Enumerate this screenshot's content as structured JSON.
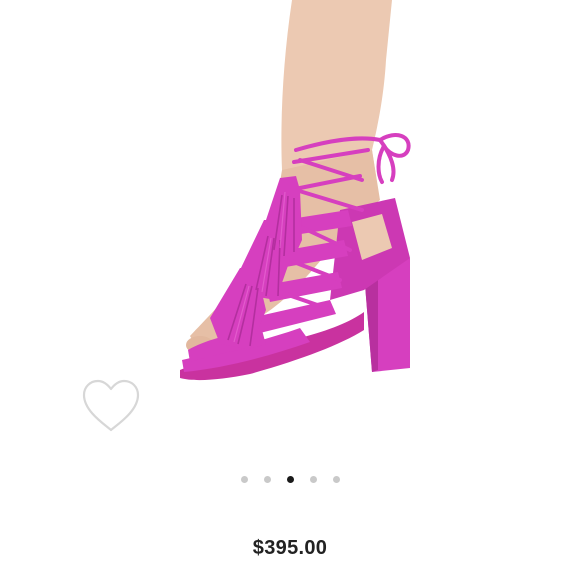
{
  "product": {
    "image_description_icon": "product-photo-pink-tassel-lace-up-heel",
    "price": "$395.00"
  },
  "favorite": {
    "icon": "heart-outline-icon"
  },
  "carousel": {
    "total": 5,
    "active_index": 2
  },
  "colors": {
    "shoe": "#d63fbf",
    "shoe_shadow": "#a82a95",
    "skin": "#ecc9b2",
    "dot_inactive": "#c9c9c9",
    "dot_active": "#1a1a1a",
    "heart_stroke": "#d7d7d7",
    "price_text": "#222222"
  }
}
